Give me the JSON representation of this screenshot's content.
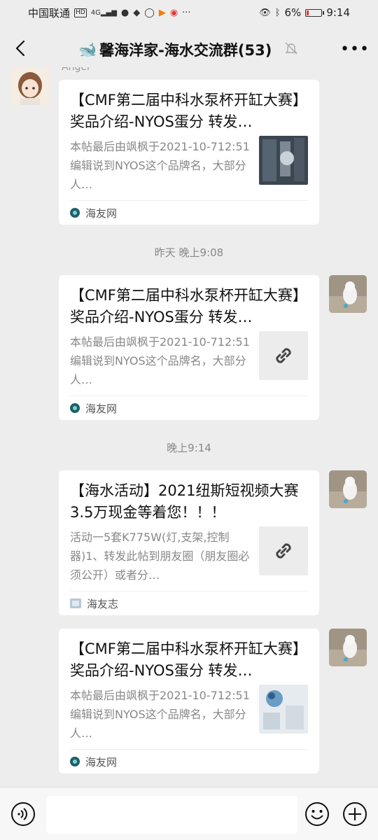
{
  "status_bar": {
    "carrier": "中国联通",
    "hd": "HD",
    "signal": "4G",
    "battery_pct": "6%",
    "time": "9:14"
  },
  "header": {
    "emoji": "🐋",
    "title": "馨海洋家-海水交流群(53)"
  },
  "messages": [
    {
      "sender": "Angel",
      "title": "【CMF第二届中科水泵杯开缸大赛】奖品介绍-NYOS蛋分 转发…",
      "desc": "本帖最后由飒枫于2021-10-712:51编辑说到NYOS这个品牌名，大部分人…",
      "source": "海友网"
    },
    {
      "time": "昨天 晚上9:08",
      "title": "【CMF第二届中科水泵杯开缸大赛】奖品介绍-NYOS蛋分 转发…",
      "desc": "本帖最后由飒枫于2021-10-712:51编辑说到NYOS这个品牌名，大部分人…",
      "source": "海友网"
    },
    {
      "time": "晚上9:14",
      "title": "【海水活动】2021纽斯短视频大赛 3.5万现金等着您！！！",
      "desc": "活动一5套K775W(灯,支架,控制器)1、转发此帖到朋友圈（朋友圈必须公开）或者分…",
      "source": "海友志"
    },
    {
      "title": "【CMF第二届中科水泵杯开缸大赛】奖品介绍-NYOS蛋分 转发…",
      "desc": "本帖最后由飒枫于2021-10-712:51编辑说到NYOS这个品牌名，大部分人…",
      "source": "海友网"
    }
  ]
}
